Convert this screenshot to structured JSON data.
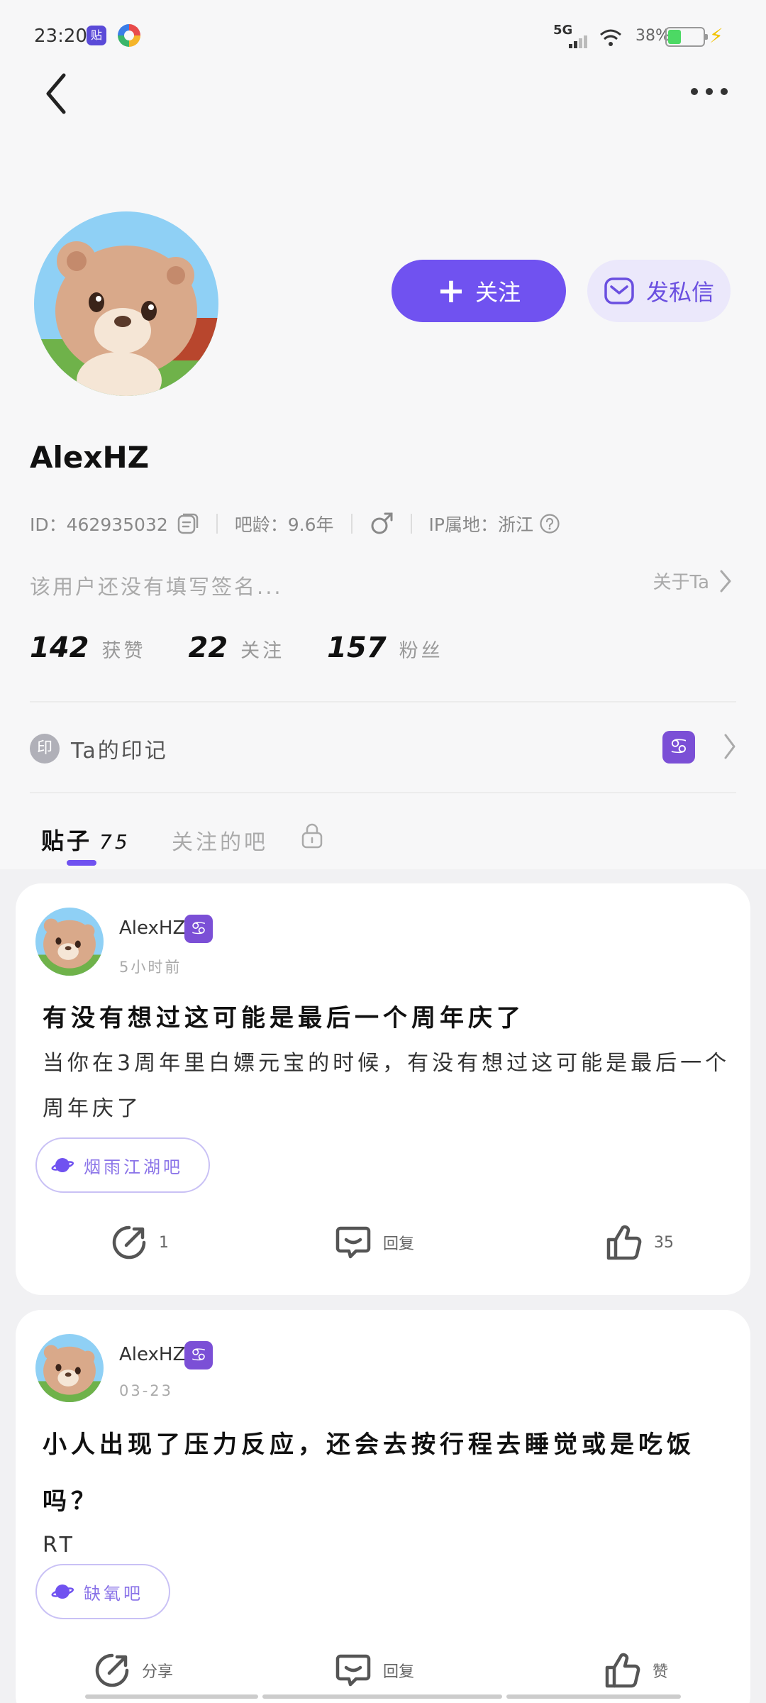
{
  "status": {
    "time": "23:20",
    "app1": "贴",
    "network": "5G",
    "battery_pct": "38%",
    "battery_level": 0.38
  },
  "profile": {
    "follow_label": "关注",
    "message_label": "发私信",
    "username": "AlexHZ",
    "id_text": "ID：462935032",
    "bar_age": "吧龄：9.6年",
    "ip_location": "IP属地：浙江",
    "bio": "该用户还没有填写签名...",
    "about_ta": "关于Ta",
    "stats": [
      {
        "num": "142",
        "label": "获赞"
      },
      {
        "num": "22",
        "label": "关注"
      },
      {
        "num": "157",
        "label": "粉丝"
      }
    ],
    "mark_badge": "印",
    "mark_label": "Ta的印记",
    "zodiac": "♋"
  },
  "tabs": {
    "posts_label": "贴子",
    "posts_count": "75",
    "bars_label": "关注的吧"
  },
  "posts": [
    {
      "author": "AlexHZ",
      "badge": "♋",
      "time": "5小时前",
      "title": "有没有想过这可能是最后一个周年庆了",
      "body": "当你在3周年里白嫖元宝的时候，有没有想过这可能是最后一个周年庆了",
      "bar": "烟雨江湖吧",
      "share": "1",
      "reply": "回复",
      "likes": "35"
    },
    {
      "author": "AlexHZ",
      "badge": "♋",
      "time": "03-23",
      "title": "小人出现了压力反应，还会去按行程去睡觉或是吃饭吗？",
      "body": "RT",
      "bar": "缺氧吧",
      "share": "分享",
      "reply": "回复",
      "likes": "赞"
    }
  ],
  "colors": {
    "accent": "#7052f0",
    "zodiac_badge": "#7b4fd6",
    "battery": "#4cd964"
  }
}
